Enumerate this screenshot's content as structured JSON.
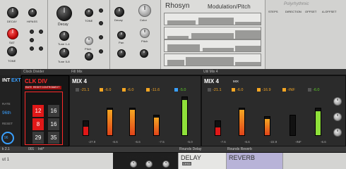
{
  "colors": {
    "accent_orange": "#f5a623",
    "clk_red": "#e01818",
    "panel_bg": "#d6d6d4",
    "dark_bg": "#262626",
    "green": "#5fd02a"
  },
  "top": {
    "labels1": [
      "DECAY",
      "HIPASS",
      "SAT",
      "TONE"
    ],
    "labels2": [
      "Decay",
      "TONE",
      "Tune 1-4",
      "Tune 5-8",
      "Pitch"
    ],
    "labels3": [
      "Decay",
      "Color",
      "Pan",
      "Pitch"
    ],
    "rhosyn_title": "Rhosyn",
    "modpitch_title": "Modulation/Pitch",
    "polyrhythmic_label": "Polyrhythmic",
    "seq_cols": [
      "STEPS",
      "DIRECTION",
      "OFFSET",
      "A-OFFSET"
    ]
  },
  "left": {
    "int": "INT",
    "ext": "EXT",
    "rate_label": "RATE",
    "rate_value": "96th",
    "reset_label": "RESET",
    "reset_value": "96"
  },
  "clock": {
    "title": "Clock Divider",
    "header": "CLK DIV",
    "sub": [
      "RATE",
      "RESET",
      "CONTROL",
      "NEXT"
    ],
    "cells": [
      "12",
      "16",
      "8",
      "16",
      "29",
      "35"
    ]
  },
  "mix1": {
    "titlebar": "Fill Mix",
    "title": "MIX 4",
    "channels": [
      {
        "val": "-21.1",
        "bottom": "-27.9"
      },
      {
        "val": "-6.0",
        "bottom": "-6.6"
      },
      {
        "val": "-6.0",
        "bottom": "-6.6"
      },
      {
        "val": "-11.6",
        "bottom": "-7.5"
      },
      {
        "val": "-5.0",
        "bottom": "-5.0"
      }
    ]
  },
  "mix2": {
    "titlebar": "Util Mix 4",
    "title": "MIX 4",
    "mix_badge": "MIX",
    "channels": [
      {
        "val": "-21.1",
        "bottom": "-7.6"
      },
      {
        "val": "-6.0",
        "bottom": "-6.6"
      },
      {
        "val": "-16.9",
        "bottom": "-22.9"
      },
      {
        "val": "-INF",
        "bottom": "-INF"
      },
      {
        "val": "-6.0",
        "bottom": "-6.6"
      }
    ]
  },
  "bottom": {
    "left_tab": "k 2.1",
    "preset_num": "001",
    "preset_name": "Init*",
    "delay_title": "Rounds Delay",
    "delay_header": "DELAY",
    "reverb_title": "Rounds Reverb",
    "reverb_header": "REVERB",
    "cols": [
      "DIRECTION",
      "STEPS",
      "OFFSET"
    ],
    "corner": "ut 1",
    "crs_label": "CRS5"
  }
}
